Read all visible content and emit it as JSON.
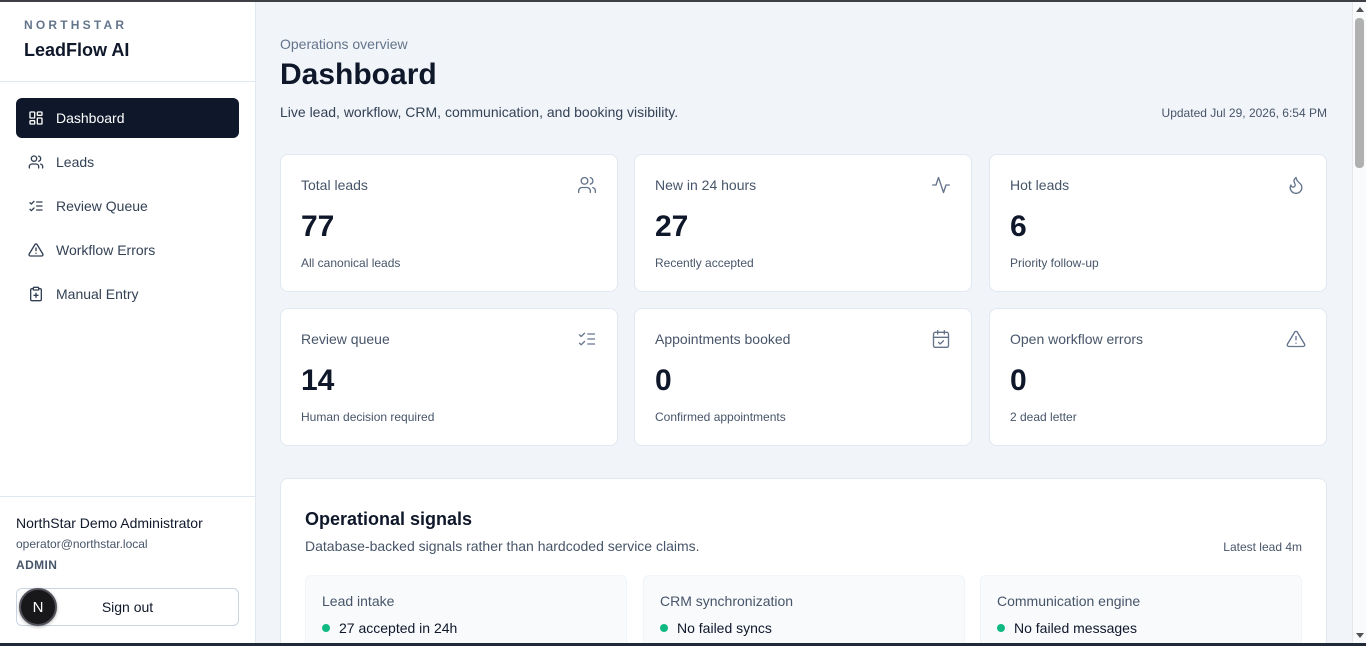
{
  "brand": {
    "org": "NORTHSTAR",
    "app": "LeadFlow AI"
  },
  "nav": [
    {
      "label": "Dashboard",
      "icon": "dashboard-grid-icon",
      "active": true
    },
    {
      "label": "Leads",
      "icon": "users-icon",
      "active": false
    },
    {
      "label": "Review Queue",
      "icon": "list-checks-icon",
      "active": false
    },
    {
      "label": "Workflow Errors",
      "icon": "warning-triangle-icon",
      "active": false
    },
    {
      "label": "Manual Entry",
      "icon": "clipboard-plus-icon",
      "active": false
    }
  ],
  "user": {
    "name": "NorthStar Demo Administrator",
    "email": "operator@northstar.local",
    "role": "ADMIN",
    "avatar_initial": "N",
    "signout_label": "Sign out"
  },
  "header": {
    "breadcrumb": "Operations overview",
    "title": "Dashboard",
    "subtitle": "Live lead, workflow, CRM, communication, and booking visibility.",
    "updated": "Updated Jul 29, 2026, 6:54 PM"
  },
  "metrics": [
    {
      "label": "Total leads",
      "value": "77",
      "note": "All canonical leads",
      "icon": "users-icon"
    },
    {
      "label": "New in 24 hours",
      "value": "27",
      "note": "Recently accepted",
      "icon": "activity-icon"
    },
    {
      "label": "Hot leads",
      "value": "6",
      "note": "Priority follow-up",
      "icon": "flame-icon"
    },
    {
      "label": "Review queue",
      "value": "14",
      "note": "Human decision required",
      "icon": "list-checks-icon"
    },
    {
      "label": "Appointments booked",
      "value": "0",
      "note": "Confirmed appointments",
      "icon": "calendar-check-icon"
    },
    {
      "label": "Open workflow errors",
      "value": "0",
      "note": "2 dead letter",
      "icon": "warning-triangle-icon"
    }
  ],
  "signals": {
    "title": "Operational signals",
    "subtitle": "Database-backed signals rather than hardcoded service claims.",
    "meta": "Latest lead 4m",
    "items": [
      {
        "name": "Lead intake",
        "status": "27 accepted in 24h"
      },
      {
        "name": "CRM synchronization",
        "status": "No failed syncs"
      },
      {
        "name": "Communication engine",
        "status": "No failed messages"
      }
    ]
  },
  "colors": {
    "primary": "#0f172a",
    "background": "#f1f5f9",
    "status_ok": "#10b981"
  }
}
